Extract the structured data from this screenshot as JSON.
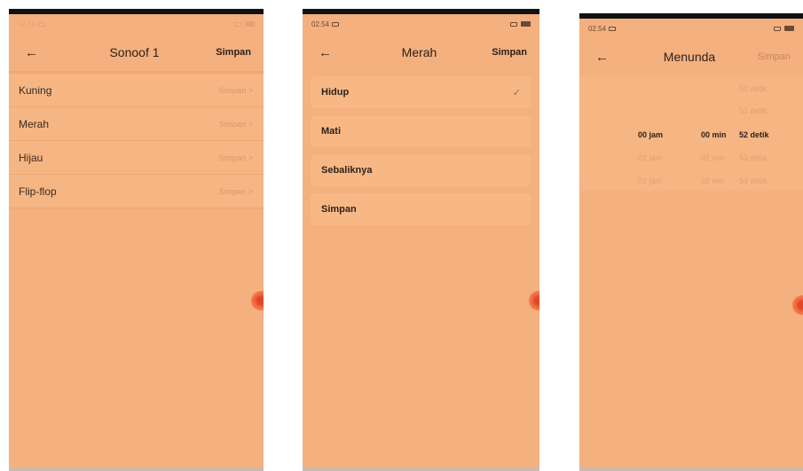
{
  "screen1": {
    "status_time": "02.54",
    "title": "Sonoof 1",
    "save_label": "Simpan",
    "items": [
      {
        "label": "Kuning",
        "value": "Simpan",
        "chevron": ">"
      },
      {
        "label": "Merah",
        "value": "Simpan",
        "chevron": ">"
      },
      {
        "label": "Hijau",
        "value": "Simpan",
        "chevron": ">"
      },
      {
        "label": "Flip-flop",
        "value": "Simpan",
        "chevron": ">"
      }
    ]
  },
  "screen2": {
    "status_time": "02.54",
    "title": "Merah",
    "save_label": "Simpan",
    "options": [
      {
        "label": "Hidup",
        "selected": true
      },
      {
        "label": "Mati"
      },
      {
        "label": "Sebaliknya"
      },
      {
        "label": "Simpan"
      }
    ],
    "check_glyph": "✓"
  },
  "screen3": {
    "status_time": "02.54",
    "title": "Menunda",
    "save_label": "Simpan",
    "hours": [
      "00 jam",
      "01 jam",
      "02 jam"
    ],
    "minutes": [
      "00 min",
      "01 min",
      "02 min"
    ],
    "seconds": [
      "50 detik",
      "51 detik",
      "52 detik",
      "53 detik",
      "54 detik"
    ]
  },
  "icons": {
    "back": "←",
    "check": "check-icon",
    "floating": "floating-ball-icon"
  },
  "colors": {
    "background": "#f4b07f",
    "row": "#f6b684",
    "text": "#2e211a",
    "muted": "#d69670",
    "accent": "#e0472a"
  }
}
